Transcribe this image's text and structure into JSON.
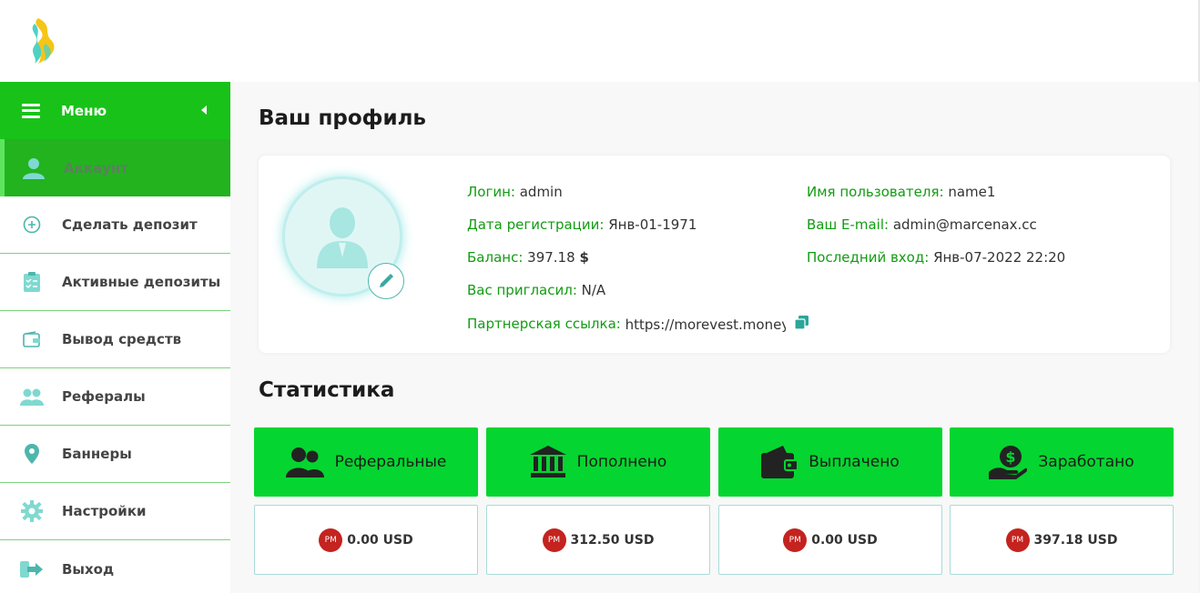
{
  "sidebar": {
    "menu_label": "Меню",
    "items": [
      {
        "label": "Аккаунт",
        "icon": "user-icon",
        "active": true
      },
      {
        "label": "Сделать депозит",
        "icon": "plus-circle-icon"
      },
      {
        "label": "Активные депозиты",
        "icon": "clipboard-icon"
      },
      {
        "label": "Вывод средств",
        "icon": "wallet-icon"
      },
      {
        "label": "Рефералы",
        "icon": "users-icon"
      },
      {
        "label": "Баннеры",
        "icon": "map-pin-icon"
      },
      {
        "label": "Настройки",
        "icon": "gear-icon"
      },
      {
        "label": "Выход",
        "icon": "logout-icon"
      }
    ]
  },
  "profile": {
    "title": "Ваш профиль",
    "login_label": "Логин:",
    "login_value": "admin",
    "reg_label": "Дата регистрации:",
    "reg_value": "Янв-01-1971",
    "balance_label": "Баланс:",
    "balance_value": "397.18",
    "balance_currency": "$",
    "invited_label": "Вас пригласил:",
    "invited_value": "N/A",
    "ref_label": "Партнерская ссылка:",
    "ref_value": "https://morevest.money/?ref=admin",
    "username_label": "Имя пользователя:",
    "username_value": "name1",
    "email_label": "Ваш E-mail:",
    "email_value": "admin@marcenax.cc",
    "last_login_label": "Последний вход:",
    "last_login_value": "Янв-07-2022 22:20"
  },
  "stats": {
    "title": "Статистика",
    "currency_badge": "PM",
    "cards": [
      {
        "label": "Реферальные",
        "value": "0.00 USD",
        "icon": "users-icon"
      },
      {
        "label": "Пополнено",
        "value": "312.50 USD",
        "icon": "bank-icon"
      },
      {
        "label": "Выплачено",
        "value": "0.00 USD",
        "icon": "wallet-icon"
      },
      {
        "label": "Заработано",
        "value": "397.18 USD",
        "icon": "money-hand-icon"
      }
    ]
  },
  "colors": {
    "brand_green": "#19c219",
    "card_green": "#05d530",
    "label_green": "#129c12",
    "accent_teal": "#4db6ac",
    "pm_red": "#c4231f"
  }
}
